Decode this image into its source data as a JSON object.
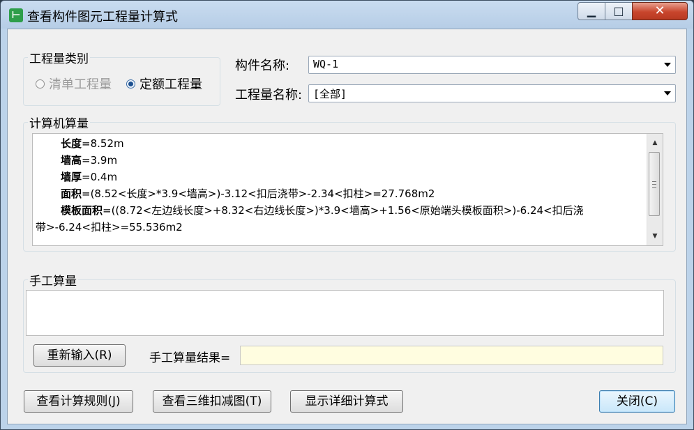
{
  "window": {
    "title": "查看构件图元工程量计算式",
    "app_icon": "app-logo-icon",
    "controls": {
      "minimize": "▁",
      "maximize": "□",
      "close": "✕"
    }
  },
  "qty_type": {
    "group_title": "工程量类别",
    "option_list": "清单工程量",
    "option_quota": "定额工程量",
    "selected": "定额工程量"
  },
  "component": {
    "label": "构件名称:",
    "value": "WQ-1"
  },
  "qty_name": {
    "label": "工程量名称:",
    "value": "[全部]"
  },
  "computer_calc": {
    "group_title": "计算机算量",
    "lines": [
      {
        "key": "长度",
        "expr": "=8.52m"
      },
      {
        "key": "墙高",
        "expr": "=3.9m"
      },
      {
        "key": "墙厚",
        "expr": "=0.4m"
      },
      {
        "key": "面积",
        "expr": "=(8.52<长度>*3.9<墙高>)-3.12<扣后浇带>-2.34<扣柱>=27.768m2"
      },
      {
        "key": "模板面积",
        "expr": "=((8.72<左边线长度>+8.32<右边线长度>)*3.9<墙高>+1.56<原始端头模板面积>)-6.24<扣后浇",
        "cont": "带>-6.24<扣柱>=55.536m2"
      }
    ]
  },
  "manual_calc": {
    "group_title": "手工算量",
    "input_value": "",
    "reenter_button": "重新输入(R)",
    "result_label": "手工算量结果=",
    "result_value": ""
  },
  "footer": {
    "view_rules_button": "查看计算规则(J)",
    "view_3d_button": "查看三维扣减图(T)",
    "show_detail_button": "显示详细计算式",
    "close_button": "关闭(C)"
  }
}
